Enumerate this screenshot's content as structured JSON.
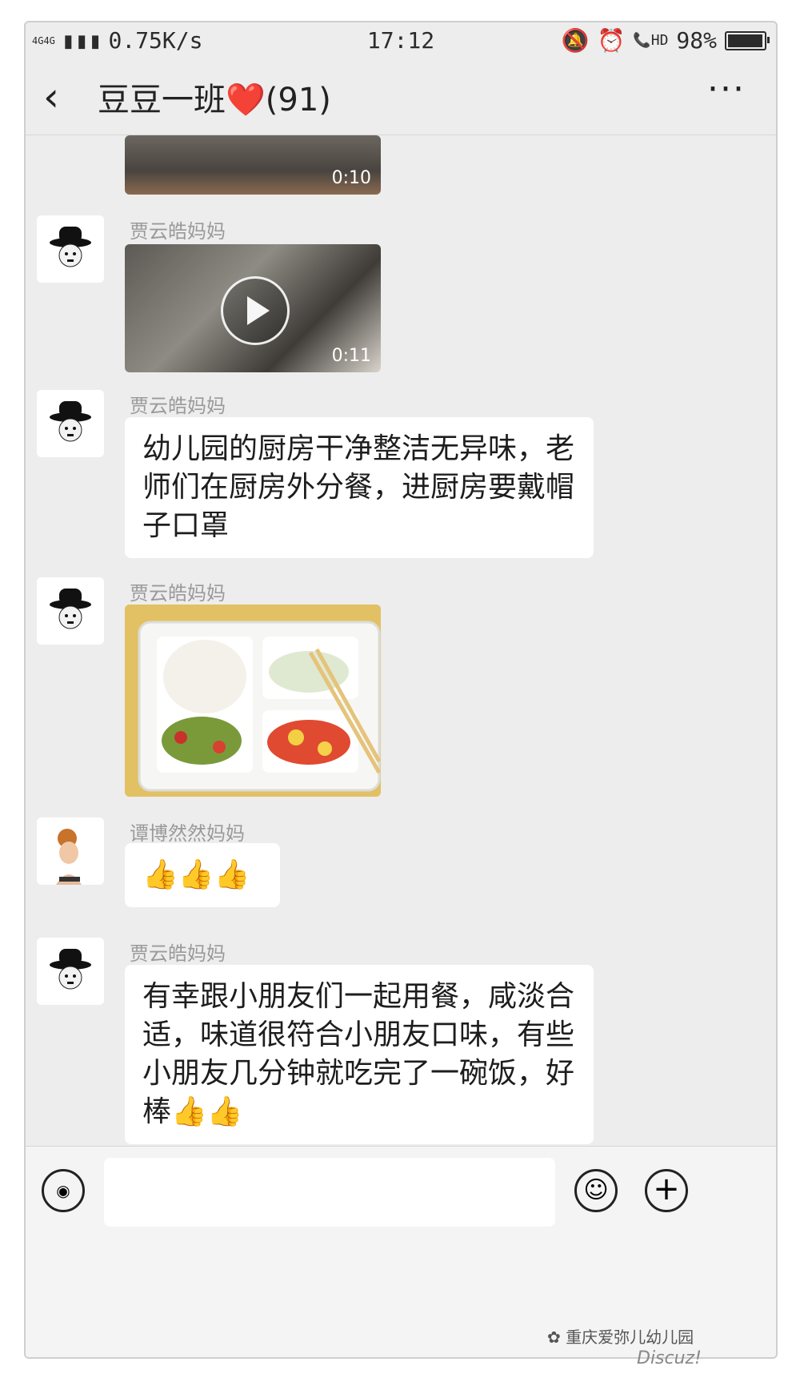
{
  "statusbar": {
    "network": "4G4G",
    "speed": "0.75K/s",
    "time": "17:12",
    "battery": "98%",
    "battery_level": 0.98
  },
  "titlebar": {
    "back_icon": "chevron-left-icon",
    "title": "豆豆一班❤️(91)",
    "more_label": "···"
  },
  "chat": {
    "video1": {
      "duration": "0:10"
    },
    "msg1": {
      "sender": "贾云皓妈妈",
      "type": "video",
      "duration": "0:11"
    },
    "msg2": {
      "sender": "贾云皓妈妈",
      "text": "幼儿园的厨房干净整洁无异味，老师们在厨房外分餐，进厨房要戴帽子口罩"
    },
    "msg3": {
      "sender": "贾云皓妈妈",
      "type": "image"
    },
    "msg4": {
      "sender": "谭博然然妈妈",
      "text": "👍👍👍"
    },
    "msg5": {
      "sender": "贾云皓妈妈",
      "text": "有幸跟小朋友们一起用餐，咸淡合适，味道很符合小朋友口味，有些小朋友几分钟就吃完了一碗饭，好棒👍👍"
    }
  },
  "inputbar": {
    "voice_icon": "voice-icon",
    "emoji_icon": "emoji-icon",
    "plus_icon": "plus-icon"
  },
  "watermark": {
    "text": "重庆爱弥儿幼儿园",
    "discuz": "Discuz!"
  },
  "colors": {
    "background": "#ededed",
    "bubble": "#ffffff",
    "sender": "#9a9a9a"
  }
}
